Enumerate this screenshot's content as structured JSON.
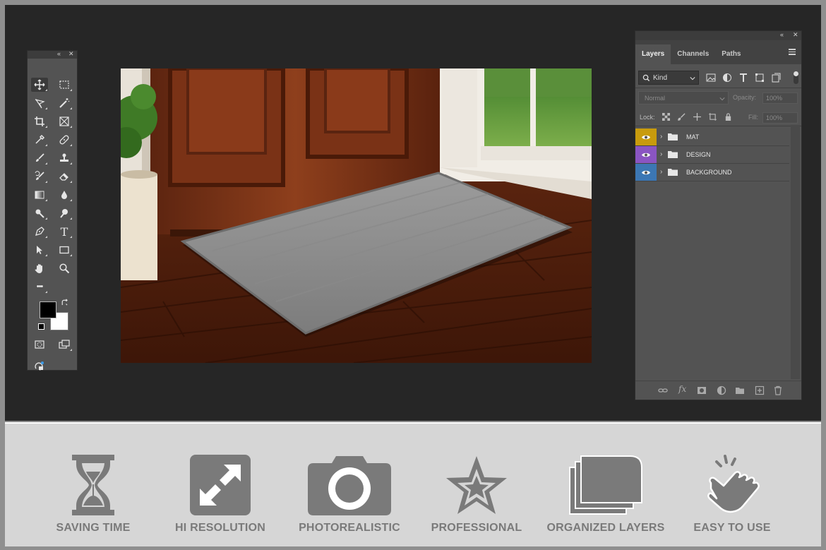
{
  "colors": {
    "frame": "#8f8f8f",
    "workspace": "#262626",
    "panel": "#535353",
    "panel_header": "#3c3c3c",
    "bottom_bar": "#d6d6d6",
    "feature_icon": "#7a7a7a",
    "layer_mat": "#c89b0d",
    "layer_design": "#8a55c2",
    "layer_background": "#3c77b4"
  },
  "tools_panel": {
    "header_icons": [
      "collapse-icon",
      "close-icon"
    ],
    "tools": [
      "move-icon",
      "marquee-icon",
      "lasso-icon",
      "magic-wand-icon",
      "crop-icon",
      "frame-icon",
      "eyedropper-icon",
      "healing-icon",
      "brush-icon",
      "stamp-icon",
      "history-brush-icon",
      "eraser-icon",
      "gradient-icon",
      "blur-icon",
      "dodge-icon",
      "burn-icon",
      "pen-icon",
      "type-icon",
      "path-select-icon",
      "rectangle-icon",
      "hand-icon",
      "zoom-icon",
      "more-icon",
      "swap-icon",
      "quick-mask-icon",
      "screen-mode-icon",
      "edit-toolbar-icon"
    ],
    "type_tool_glyph": "T",
    "more_glyph": "•••",
    "foreground_color": "#000000",
    "background_color": "#ffffff"
  },
  "layers_panel": {
    "tabs": [
      {
        "label": "Layers",
        "active": true
      },
      {
        "label": "Channels",
        "active": false
      },
      {
        "label": "Paths",
        "active": false
      }
    ],
    "filter_kind": "Kind",
    "blend_mode": "Normal",
    "opacity_label": "Opacity:",
    "opacity_value": "100%",
    "lock_label": "Lock:",
    "fill_label": "Fill:",
    "fill_value": "100%",
    "layers": [
      {
        "name": "MAT",
        "color": "#c89b0d"
      },
      {
        "name": "DESIGN",
        "color": "#8a55c2"
      },
      {
        "name": "BACKGROUND",
        "color": "#3c77b4"
      }
    ],
    "footer_icons": [
      "link-icon",
      "fx-icon",
      "mask-icon",
      "adjustment-icon",
      "group-icon",
      "new-layer-icon",
      "trash-icon"
    ],
    "fx_glyph": "fx"
  },
  "features": [
    {
      "label": "SAVING TIME",
      "icon": "hourglass-icon"
    },
    {
      "label": "HI RESOLUTION",
      "icon": "expand-icon"
    },
    {
      "label": "PHOTOREALISTIC",
      "icon": "camera-icon"
    },
    {
      "label": "PROFESSIONAL",
      "icon": "star-icon"
    },
    {
      "label": "ORGANIZED LAYERS",
      "icon": "folders-icon"
    },
    {
      "label": "EASY TO USE",
      "icon": "tap-hand-icon"
    }
  ]
}
